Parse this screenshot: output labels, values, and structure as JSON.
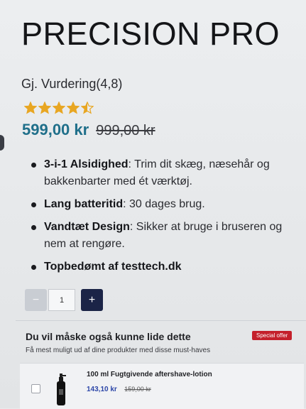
{
  "product": {
    "title": "PRECISION PRO",
    "rating_text": "Gj. Vurdering(4,8)",
    "rating_value": 4.5,
    "rating_max": 5,
    "price_new": "599,00 kr",
    "price_old": "999,00 kr"
  },
  "features": [
    {
      "bold": "3-i-1 Alsidighed",
      "text": ": Trim dit skæg, næsehår og bakkenbarter med ét værktøj."
    },
    {
      "bold": "Lang batteritid",
      "text": ": 30 dages brug."
    },
    {
      "bold": "Vandtæt Design",
      "text": ": Sikker at bruge i bruseren og nem at rengøre."
    },
    {
      "bold": "Topbedømt af testtech.dk",
      "text": ""
    }
  ],
  "quantity": {
    "minus_label": "−",
    "value": "1",
    "plus_label": "+"
  },
  "upsell": {
    "title": "Du vil måske også kunne lide dette",
    "badge": "Special offer",
    "subtitle": "Få mest muligt ud af dine produkter med disse must-haves",
    "item": {
      "name": "100 ml Fugtgivende aftershave-lotion",
      "price_new": "143,10 kr",
      "price_old": "159,00 kr"
    }
  },
  "colors": {
    "price": "#1f6f8a",
    "star": "#e8a622",
    "plus_button": "#1b2447",
    "badge": "#c4202b",
    "offer_price": "#2c46a8"
  }
}
